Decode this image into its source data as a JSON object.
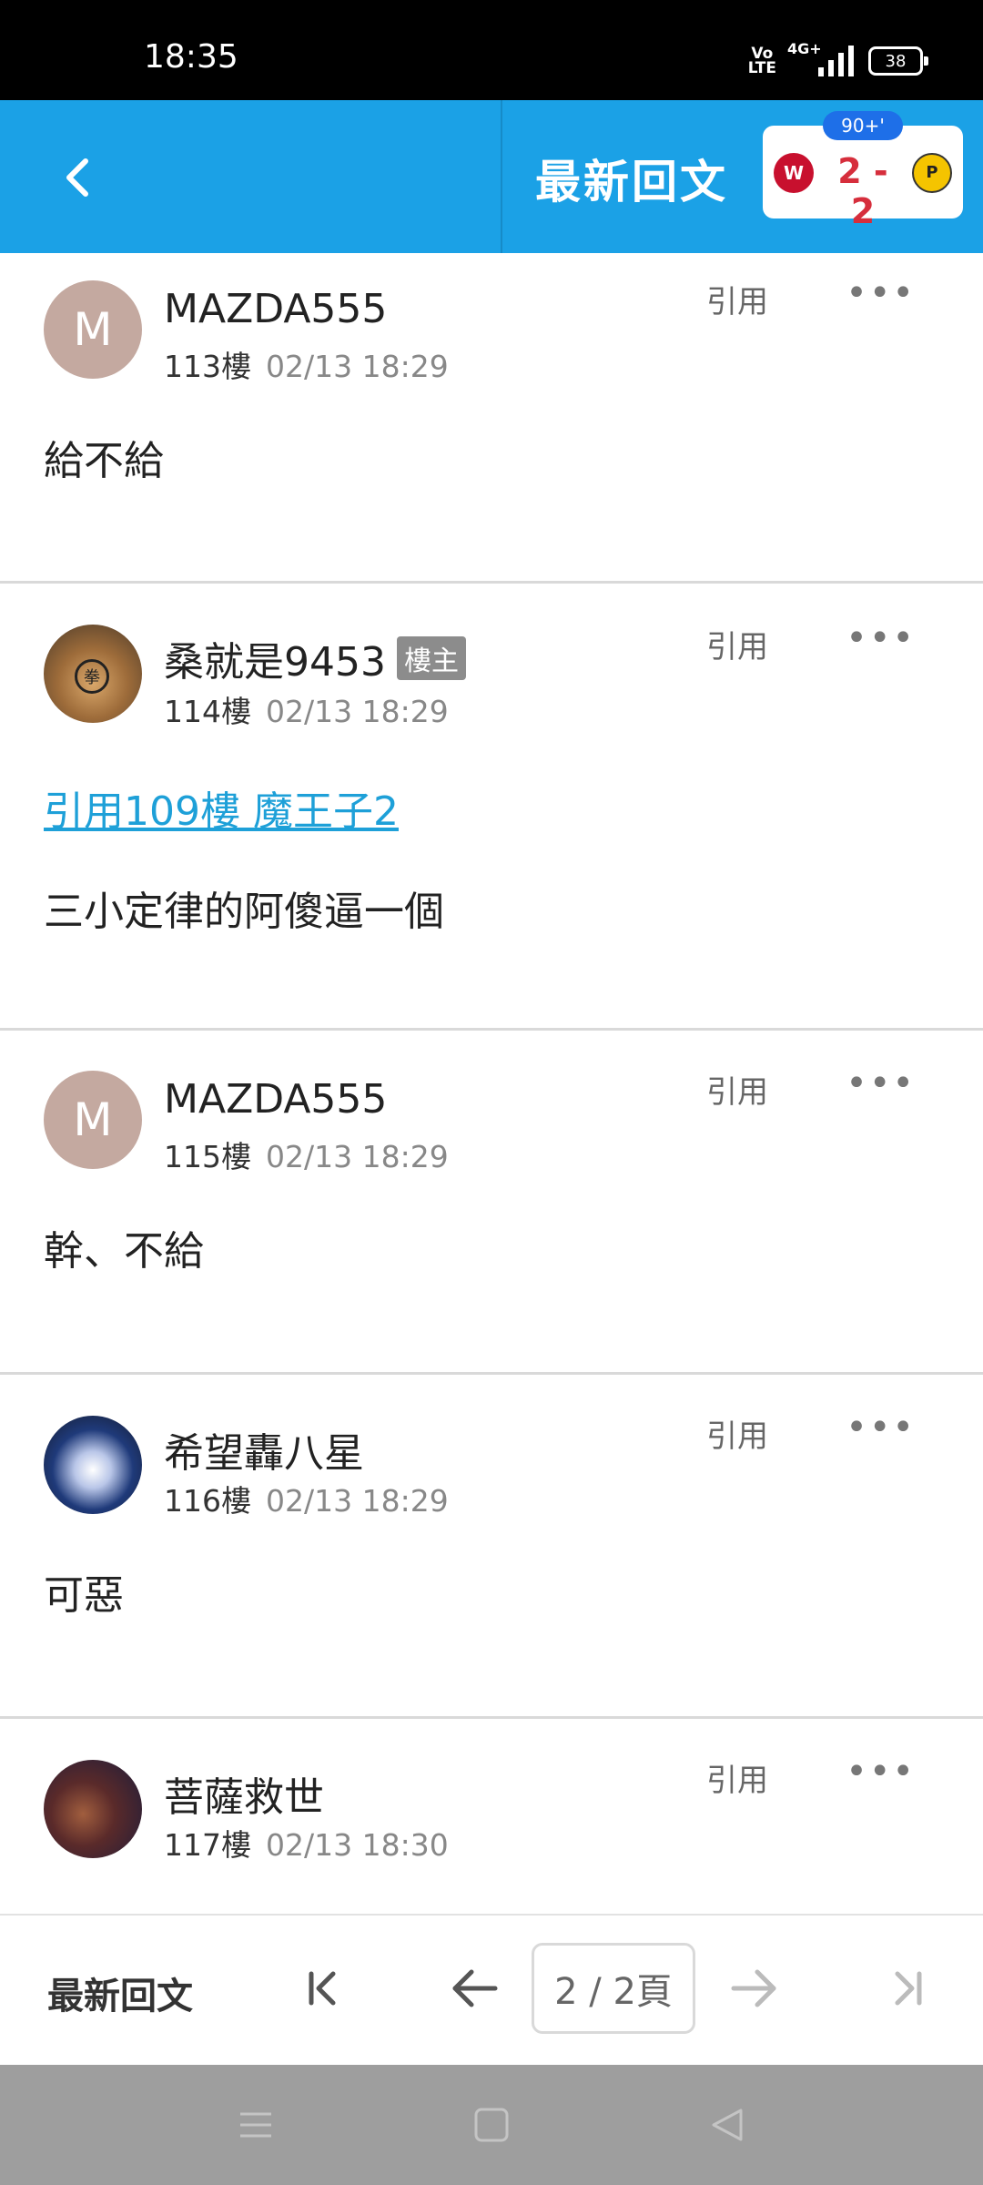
{
  "status_bar": {
    "time": "18:35",
    "volte": "Vo LTE",
    "network": "4G+",
    "battery": "38"
  },
  "header": {
    "title": "最新回文",
    "score": {
      "minute": "90+'",
      "result": "2 - 2"
    }
  },
  "posts": [
    {
      "author": "MAZDA555",
      "avatar_letter": "M",
      "floor": "113樓",
      "date": "02/13 18:29",
      "content": "給不給",
      "quote_label": "引用",
      "more": "•••"
    },
    {
      "author": "桑就是9453",
      "owner_badge": "樓主",
      "avatar_badge": "拳",
      "floor": "114樓",
      "date": "02/13 18:29",
      "reference": "引用109樓 魔王子2",
      "content": "三小定律的阿傻逼一個",
      "quote_label": "引用",
      "more": "•••"
    },
    {
      "author": "MAZDA555",
      "avatar_letter": "M",
      "floor": "115樓",
      "date": "02/13 18:29",
      "content": "幹、不給",
      "quote_label": "引用",
      "more": "•••"
    },
    {
      "author": "希望轟八星",
      "floor": "116樓",
      "date": "02/13 18:29",
      "content": "可惡",
      "quote_label": "引用",
      "more": "•••"
    },
    {
      "author": "菩薩救世",
      "floor": "117樓",
      "date": "02/13 18:30",
      "quote_label": "引用",
      "more": "•••"
    }
  ],
  "bottom_bar": {
    "label": "最新回文",
    "page_indicator": "2 / 2頁"
  },
  "colors": {
    "header_bg": "#1ba1e6",
    "link": "#1ea0d8",
    "score": "#d62e3c"
  }
}
